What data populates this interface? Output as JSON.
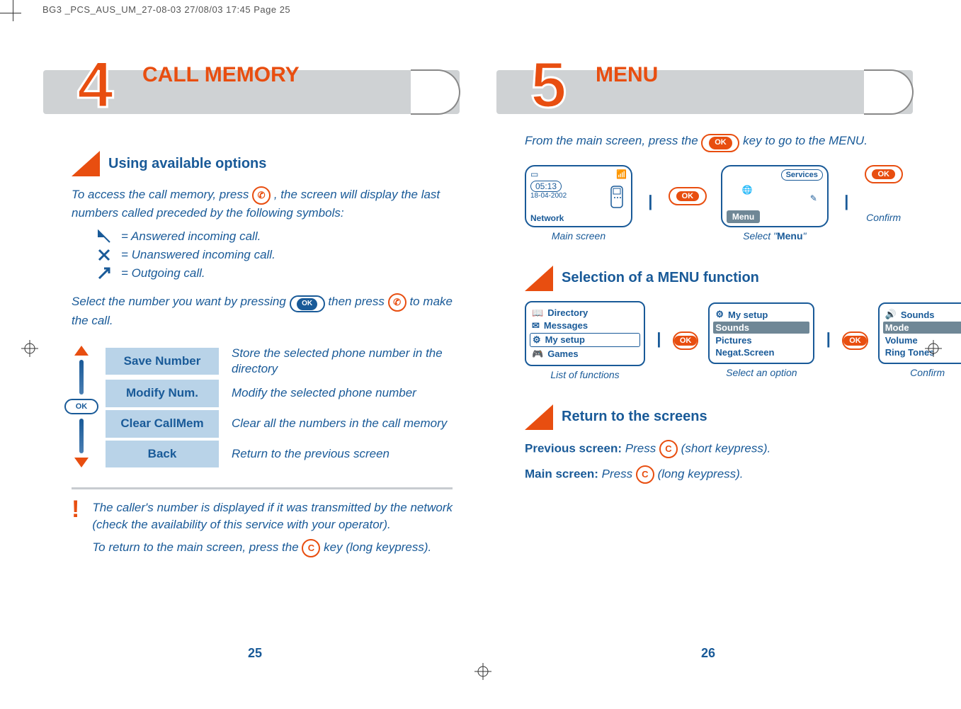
{
  "header": {
    "doc_tag": "BG3 _PCS_AUS_UM_27-08-03  27/08/03  17:45  Page 25"
  },
  "left": {
    "big_number": "4",
    "title": "CALL MEMORY",
    "section1_title": "Using available options",
    "intro": "To access the call memory, press ",
    "intro_after": " , the screen will display the last numbers called preceded by the following symbols:",
    "symbols": {
      "answered": "=   Answered incoming call.",
      "unanswered": "=   Unanswered incoming call.",
      "outgoing": "=   Outgoing call."
    },
    "select_text_a": "Select the number you want by pressing ",
    "select_text_b": " then press ",
    "select_text_c": " to make the call.",
    "options": [
      {
        "label": "Save Number",
        "desc": "Store the selected phone number in the directory"
      },
      {
        "label": "Modify Num.",
        "desc": "Modify the selected phone number"
      },
      {
        "label": "Clear CallMem",
        "desc": "Clear all the numbers in the call memory"
      },
      {
        "label": "Back",
        "desc": "Return to the previous screen"
      }
    ],
    "ok_label": "OK",
    "note_line1": "The caller's number is displayed if it was transmitted by the network (check the availability of this service with your operator).",
    "note_line2a": "To return to the main screen, press the ",
    "note_line2b": " key (long keypress).",
    "c_key": "C",
    "page_number": "25"
  },
  "right": {
    "big_number": "5",
    "title": "MENU",
    "intro_a": "From the main screen, press the ",
    "intro_b": " key to go to the MENU.",
    "ok_label": "OK",
    "main_screen": {
      "time": "05:13",
      "date": "18-04-2002",
      "network": "Network",
      "caption": "Main screen"
    },
    "menu_screen": {
      "services": "Services",
      "menu": "Menu",
      "caption_a": "Select \"",
      "caption_b": "Menu",
      "caption_c": "\""
    },
    "confirm_caption": "Confirm",
    "section2_title": "Selection of a MENU function",
    "fn_list": {
      "items": [
        "Directory",
        "Messages",
        "My setup",
        "Games"
      ],
      "selected_index": 2,
      "caption": "List of functions"
    },
    "fn_mid": {
      "header": "My setup",
      "items": [
        "Sounds",
        "Pictures",
        "Negat.Screen"
      ],
      "selected_index": 0,
      "caption": "Select an option"
    },
    "fn_right": {
      "header": "Sounds",
      "items": [
        "Mode",
        "Volume",
        "Ring Tones"
      ],
      "selected_index": 0,
      "caption": "Confirm"
    },
    "section3_title": "Return to the screens",
    "prev_label": "Previous screen:",
    "prev_text_a": " Press ",
    "prev_text_b": " (short keypress).",
    "main_label": "Main screen:",
    "main_text_a": " Press ",
    "main_text_b": " (long keypress).",
    "c_key": "C",
    "page_number": "26"
  }
}
